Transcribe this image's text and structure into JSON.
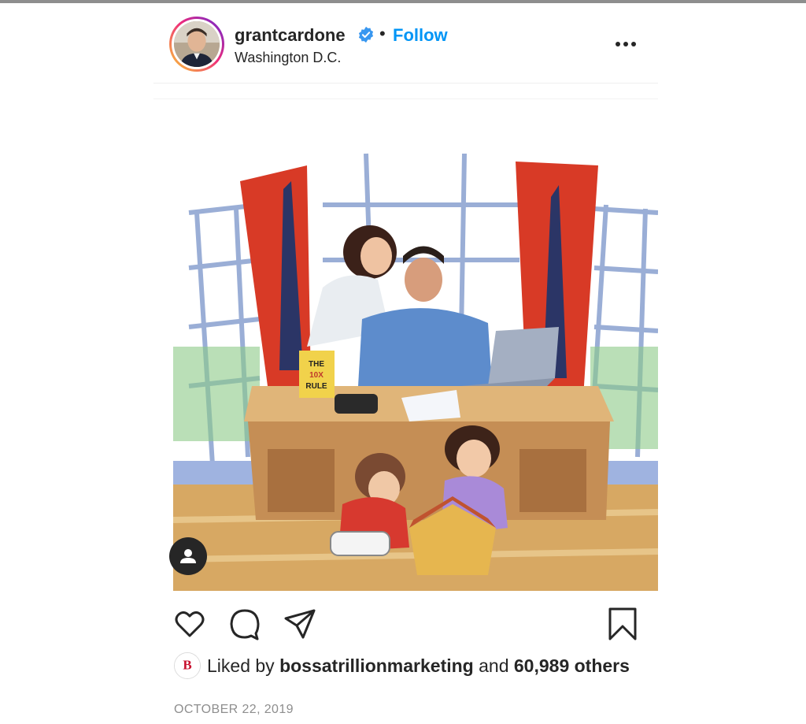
{
  "post": {
    "username": "grantcardone",
    "separator": "•",
    "follow_label": "Follow",
    "location": "Washington D.C.",
    "likes": {
      "prefix": "Liked by",
      "user": "bossatrillionmarketing",
      "conjunction": "and",
      "count": "60,989 others"
    },
    "date": "OCTOBER 22, 2019",
    "image_book_text": [
      "THE",
      "10X",
      "RULE"
    ],
    "liker_avatar_letter": "B"
  },
  "colors": {
    "link": "#0095f6",
    "verified": "#3897f0",
    "text": "#262626",
    "muted": "#8e8e8e"
  },
  "icons": [
    "verified-badge-icon",
    "more-options-icon",
    "user-tag-icon",
    "heart-icon",
    "comment-icon",
    "share-icon",
    "bookmark-icon"
  ]
}
